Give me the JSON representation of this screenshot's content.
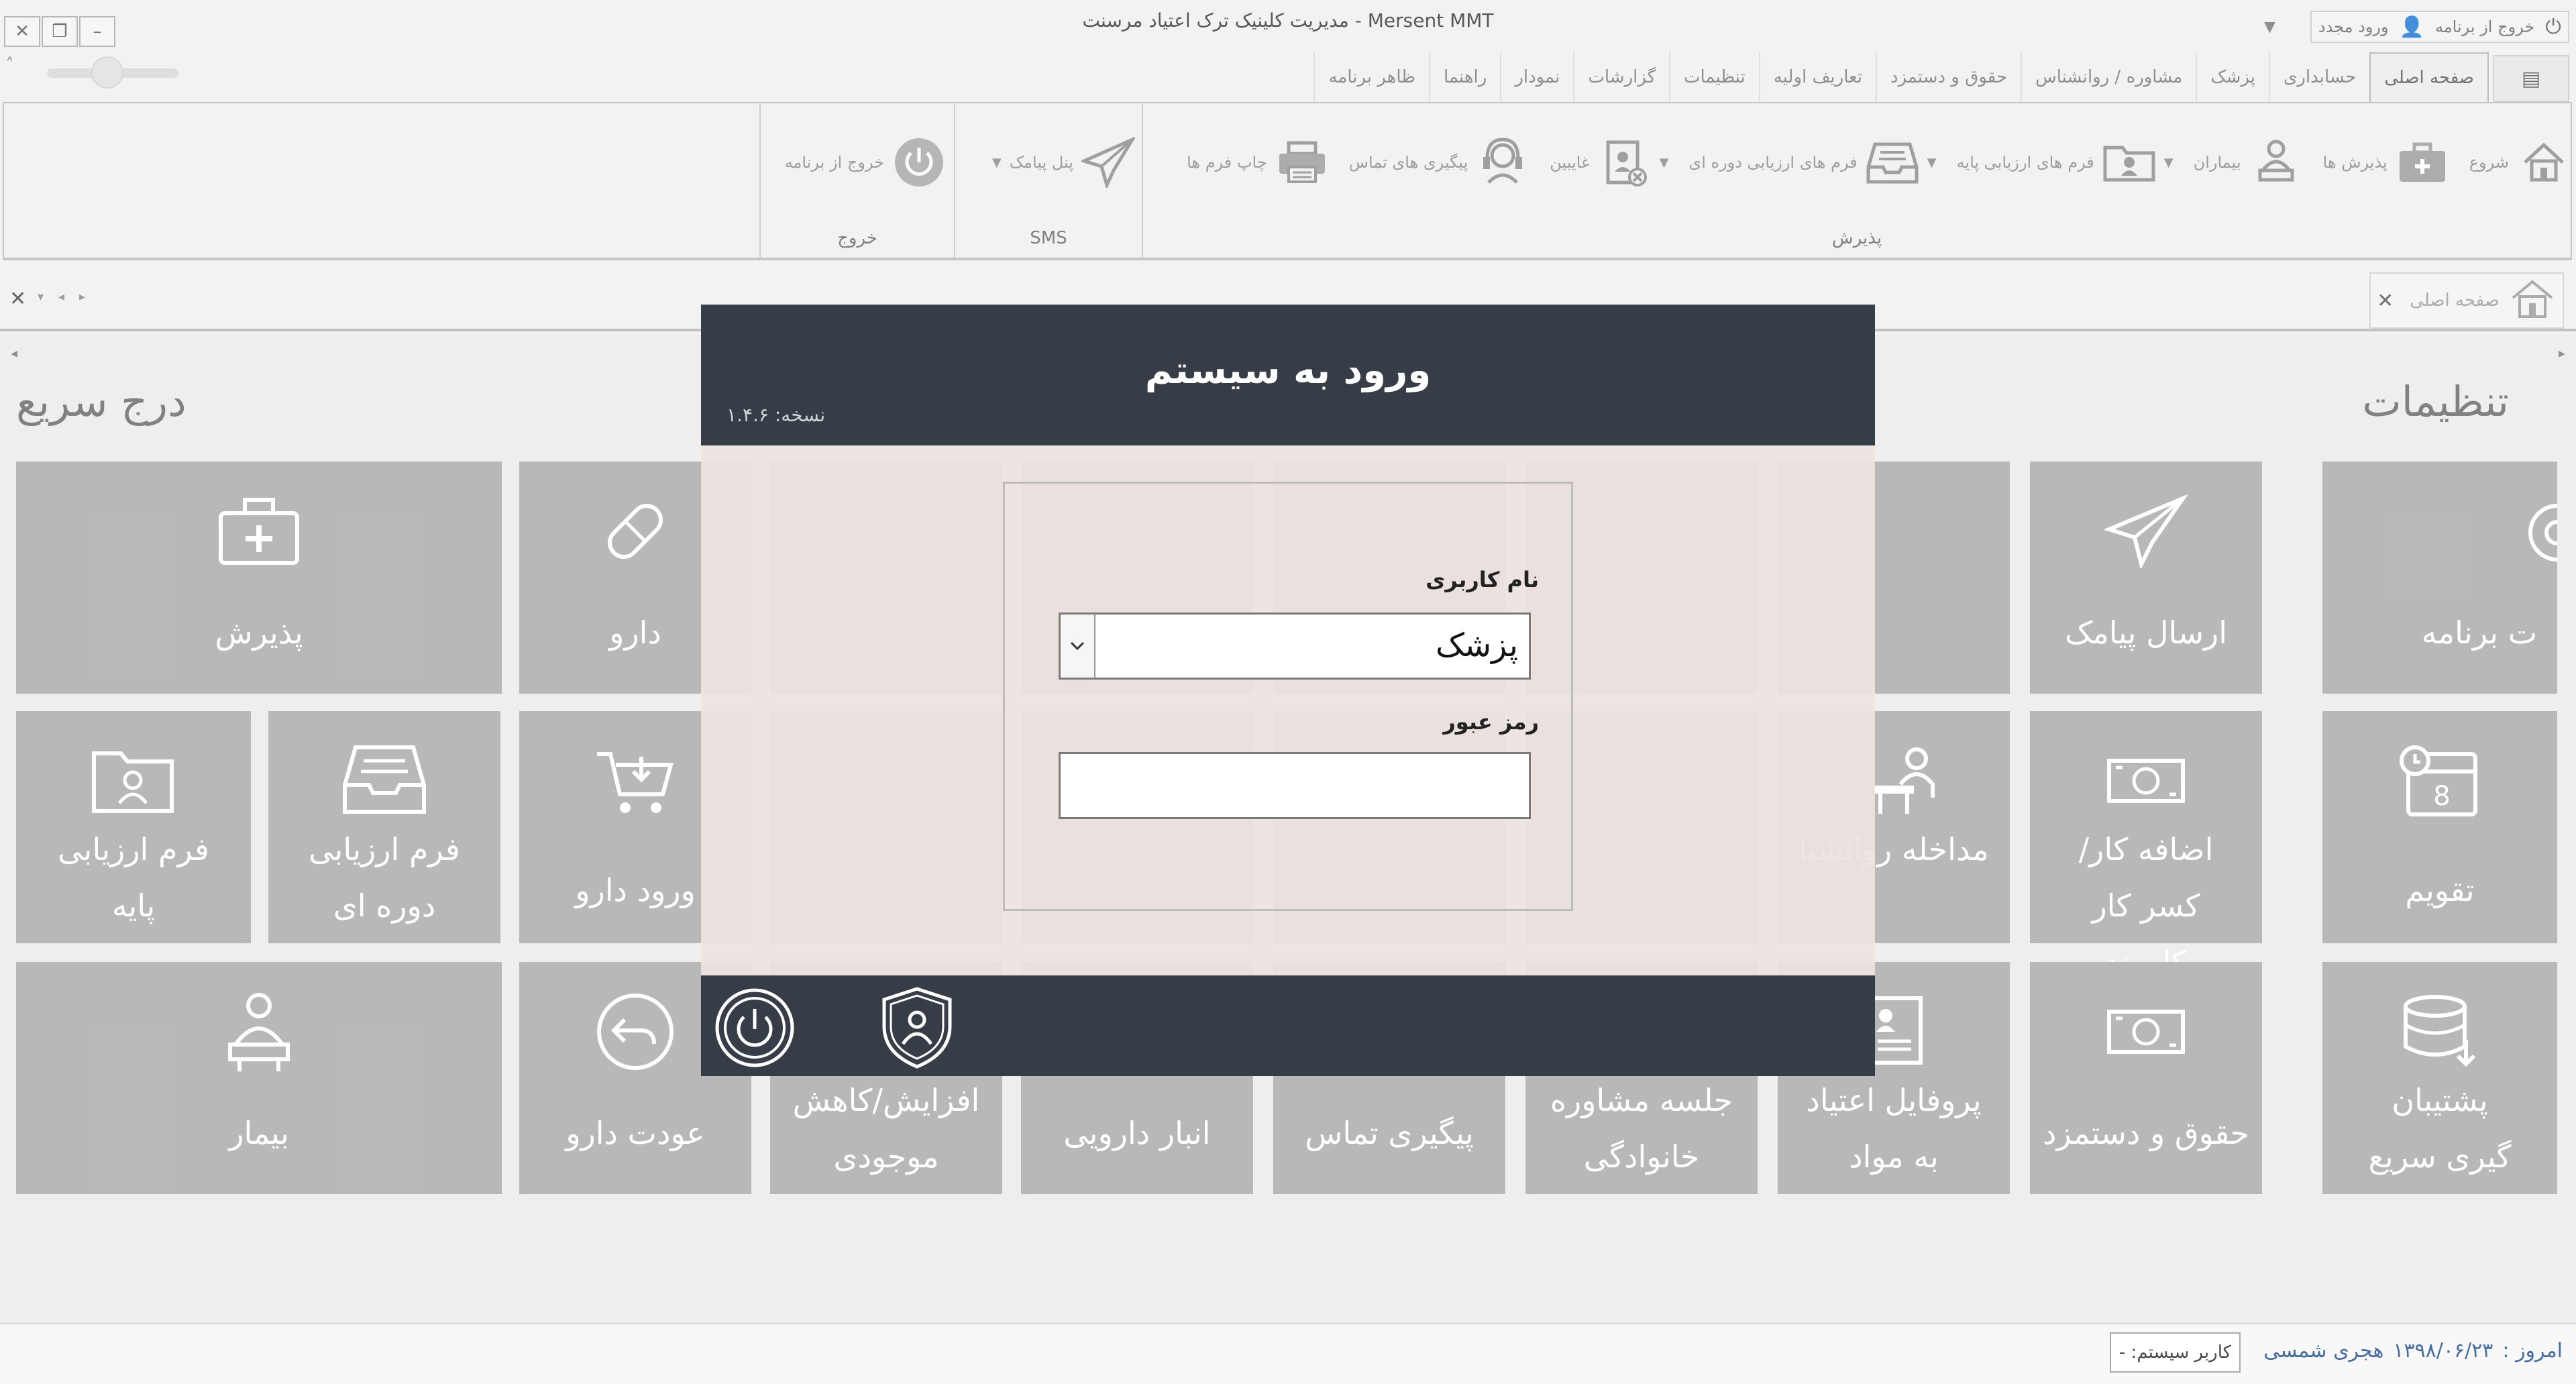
{
  "window": {
    "title": "مدیریت کلینیک ترک اعتیاد مرسنت - Mersent MMT",
    "exit_label": "خروج از برنامه",
    "relogin_label": "ورود مجدد"
  },
  "menu_tabs": [
    "صفحه اصلی",
    "حسابداری",
    "پزشک",
    "مشاوره / روانشناس",
    "حقوق و دستمزد",
    "تعاریف اولیه",
    "تنظیمات",
    "گزارشات",
    "نمودار",
    "راهنما",
    "ظاهر برنامه"
  ],
  "ribbon": {
    "groups": [
      {
        "title": "پذیرش",
        "items": [
          {
            "label": "شروع",
            "icon": "home-icon"
          },
          {
            "label": "پذیرش ها",
            "icon": "medical-kit-icon"
          },
          {
            "label": "بیماران",
            "icon": "patients-icon"
          },
          {
            "label": "فرم های ارزیابی پایه",
            "icon": "folder-user-icon",
            "dropdown": true
          },
          {
            "label": "فرم های ارزیابی دوره ای",
            "icon": "inbox-tray-icon",
            "dropdown": true
          },
          {
            "label": "غایبین",
            "icon": "absent-badge-icon",
            "dropdown": true
          },
          {
            "label": "پیگیری های تماس",
            "icon": "headset-icon"
          },
          {
            "label": "چاپ فرم ها",
            "icon": "printer-icon"
          }
        ]
      },
      {
        "title": "SMS",
        "items": [
          {
            "label": "پنل پیامک",
            "icon": "paper-plane-icon",
            "dropdown": true
          }
        ]
      },
      {
        "title": "خروج",
        "items": [
          {
            "label": "خروج از برنامه",
            "icon": "power-icon"
          }
        ]
      }
    ]
  },
  "doc_tab": {
    "label": "صفحه اصلی"
  },
  "sections": {
    "settings_title": "تنظیمات",
    "quick_insert_title": "درج سریع"
  },
  "tiles": {
    "settings": [
      "ت برنامه",
      "تقویم",
      "پشتیبان گیری سریع"
    ],
    "col2": [
      "ارسال پیامک",
      "اضافه کار/کسر کار کارمند",
      "حقوق و دستمزد"
    ],
    "col3": [
      "مداخله روانشنا",
      "پروفایل اعتیاد به مواد"
    ],
    "row3_mid": [
      "جلسه مشاوره خانوادگی",
      "پیگیری تماس",
      "انبار دارویی",
      "افزایش/کاهش موجودی",
      "عودت دارو"
    ],
    "quick": [
      "پذیرش",
      "دارو",
      "ورود دارو",
      "فرم ارزیابی دوره ای",
      "فرم ارزیابی پایه",
      "بیمار"
    ]
  },
  "status": {
    "today_label": "امروز :",
    "date": "۱۳۹۸/۰۶/۲۳",
    "calendar": "هجری شمسی",
    "system_user": "کاربر سیستم: -"
  },
  "login_dialog": {
    "title": "ورود به سیستم",
    "version": "نسخه: ۱.۴.۶",
    "username_label": "نام کاربری",
    "username_value": "پزشک",
    "password_label": "رمز عبور",
    "password_value": ""
  },
  "colors": {
    "dialog_dark": "#363d46",
    "tile_gray": "#a9a9a9",
    "status_blue": "#1f4e8c"
  }
}
